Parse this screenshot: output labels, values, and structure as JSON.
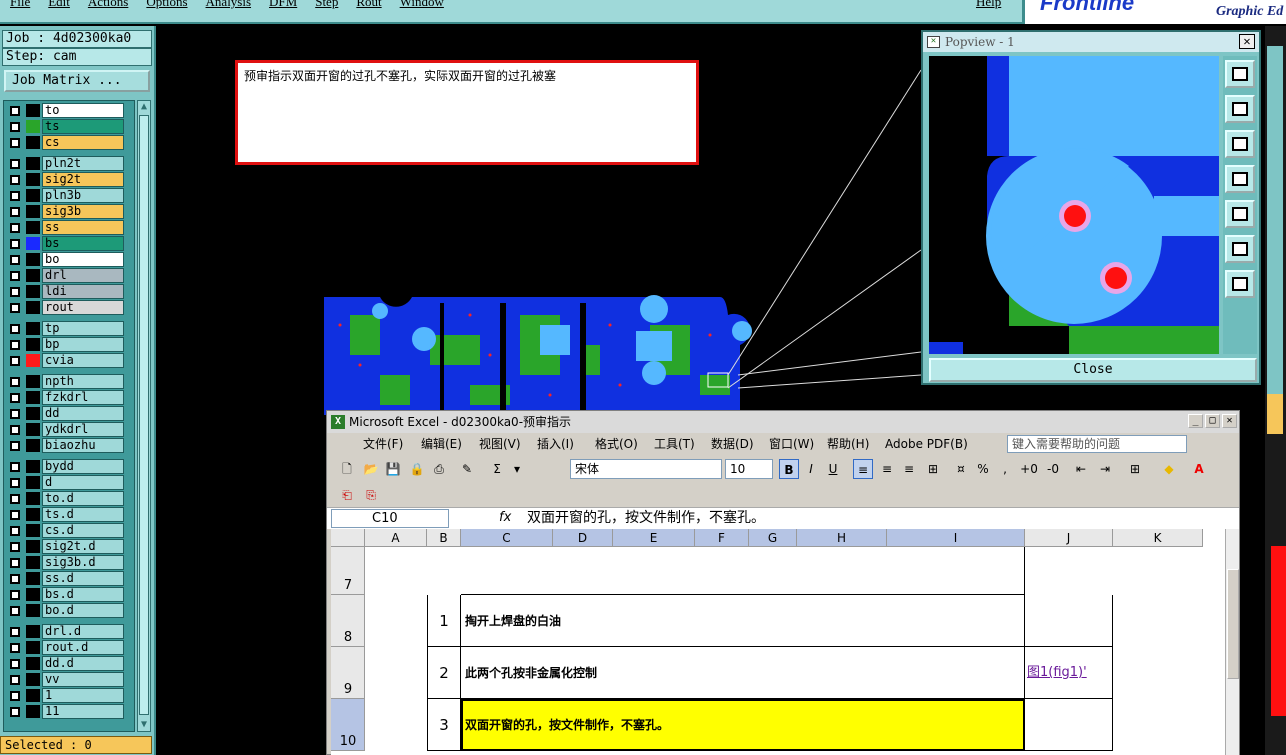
{
  "topbar": {
    "menu": [
      "File",
      "Edit",
      "Actions",
      "Options",
      "Analysis",
      "DFM",
      "Step",
      "Rout",
      "Window"
    ],
    "help": "Help",
    "brand": "Frontline",
    "brand_sub": "Graphic Ed"
  },
  "left": {
    "job": "Job : 4d02300ka0",
    "step": "Step: cam",
    "job_matrix": "Job Matrix ...",
    "selected": "Selected : 0",
    "layers": [
      {
        "name": "to",
        "color": "#ffffff",
        "swatch": "#000000"
      },
      {
        "name": "ts",
        "color": "#1d9a78",
        "swatch": "#2aa52a"
      },
      {
        "name": "cs",
        "color": "#f6c65a",
        "swatch": "#000000"
      },
      {
        "name": "pln2t",
        "color": "#9fd9d9",
        "swatch": "#000000"
      },
      {
        "name": "sig2t",
        "color": "#f6c65a",
        "swatch": "#000000"
      },
      {
        "name": "pln3b",
        "color": "#9fd9d9",
        "swatch": "#000000"
      },
      {
        "name": "sig3b",
        "color": "#f6c65a",
        "swatch": "#000000"
      },
      {
        "name": "ss",
        "color": "#f6c65a",
        "swatch": "#000000"
      },
      {
        "name": "bs",
        "color": "#1d9a78",
        "swatch": "#1a2aff"
      },
      {
        "name": "bo",
        "color": "#ffffff",
        "swatch": "#000000"
      },
      {
        "name": "drl",
        "color": "#a9b8c0",
        "swatch": "#000000"
      },
      {
        "name": "ldi",
        "color": "#a9b8c0",
        "swatch": "#000000"
      },
      {
        "name": "rout",
        "color": "#d8d8d8",
        "swatch": "#000000"
      },
      {
        "name": "tp",
        "color": "#9fd9d9",
        "swatch": "#000000"
      },
      {
        "name": "bp",
        "color": "#9fd9d9",
        "swatch": "#000000"
      },
      {
        "name": "cvia",
        "color": "#9fd9d9",
        "swatch": "#ff1a1a"
      },
      {
        "name": "npth",
        "color": "#9fd9d9",
        "swatch": "#000000"
      },
      {
        "name": "fzkdrl",
        "color": "#9fd9d9",
        "swatch": "#000000"
      },
      {
        "name": "dd",
        "color": "#9fd9d9",
        "swatch": "#000000"
      },
      {
        "name": "ydkdrl",
        "color": "#9fd9d9",
        "swatch": "#000000"
      },
      {
        "name": "biaozhu",
        "color": "#9fd9d9",
        "swatch": "#000000"
      },
      {
        "name": "bydd",
        "color": "#9fd9d9",
        "swatch": "#000000"
      },
      {
        "name": "d",
        "color": "#9fd9d9",
        "swatch": "#000000"
      },
      {
        "name": "to.d",
        "color": "#9fd9d9",
        "swatch": "#000000"
      },
      {
        "name": "ts.d",
        "color": "#9fd9d9",
        "swatch": "#000000"
      },
      {
        "name": "cs.d",
        "color": "#9fd9d9",
        "swatch": "#000000"
      },
      {
        "name": "sig2t.d",
        "color": "#9fd9d9",
        "swatch": "#000000"
      },
      {
        "name": "sig3b.d",
        "color": "#9fd9d9",
        "swatch": "#000000"
      },
      {
        "name": "ss.d",
        "color": "#9fd9d9",
        "swatch": "#000000"
      },
      {
        "name": "bs.d",
        "color": "#9fd9d9",
        "swatch": "#000000"
      },
      {
        "name": "bo.d",
        "color": "#9fd9d9",
        "swatch": "#000000"
      },
      {
        "name": "drl.d",
        "color": "#9fd9d9",
        "swatch": "#000000"
      },
      {
        "name": "rout.d",
        "color": "#9fd9d9",
        "swatch": "#000000"
      },
      {
        "name": "dd.d",
        "color": "#9fd9d9",
        "swatch": "#000000"
      },
      {
        "name": "vv",
        "color": "#9fd9d9",
        "swatch": "#000000"
      },
      {
        "name": "1",
        "color": "#9fd9d9",
        "swatch": "#000000"
      },
      {
        "name": "11",
        "color": "#9fd9d9",
        "swatch": "#000000"
      }
    ]
  },
  "note": {
    "text": "预审指示双面开窗的过孔不塞孔，实际双面开窗的过孔被塞"
  },
  "popview": {
    "title": "Popview - 1",
    "close_label": "Close",
    "tools": [
      "zoom-fit-icon",
      "pan-up-icon",
      "pan-down-icon",
      "pan-left-icon",
      "pan-right-icon",
      "zoom-out-icon",
      "zoom-in-icon"
    ]
  },
  "excel": {
    "title": "Microsoft Excel - d02300ka0-预审指示",
    "menu": [
      "文件(F)",
      "编辑(E)",
      "视图(V)",
      "插入(I)",
      "格式(O)",
      "工具(T)",
      "数据(D)",
      "窗口(W)",
      "帮助(H)",
      "Adobe PDF(B)"
    ],
    "help_placeholder": "键入需要帮助的问题",
    "font": "宋体",
    "font_size": "10",
    "name_box": "C10",
    "fx": "fx",
    "formula": "双面开窗的孔，按文件制作，不塞孔。",
    "columns": [
      "A",
      "B",
      "C",
      "D",
      "E",
      "F",
      "G",
      "H",
      "I",
      "J",
      "K"
    ],
    "rows": [
      {
        "row": "7",
        "num": "",
        "desc": "",
        "link": ""
      },
      {
        "row": "8",
        "num": "1",
        "desc": "掏开上焊盘的白油",
        "link": ""
      },
      {
        "row": "9",
        "num": "2",
        "desc": "此两个孔按非金属化控制",
        "link": "图1(fig1)'"
      },
      {
        "row": "10",
        "num": "3",
        "desc": "双面开窗的孔，按文件制作，不塞孔。",
        "link": ""
      }
    ]
  }
}
